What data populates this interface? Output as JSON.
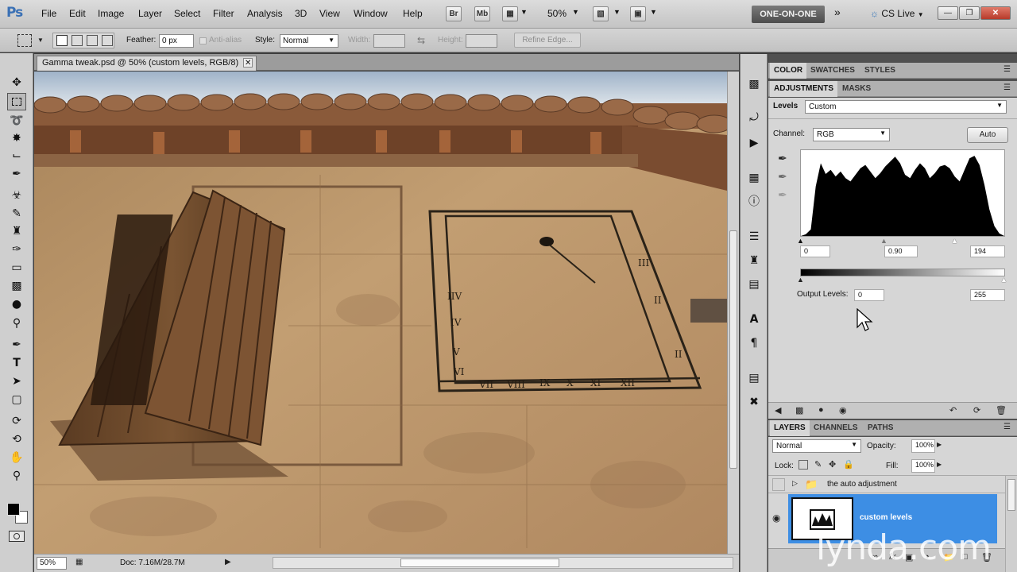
{
  "menubar": {
    "logo": "Ps",
    "items": [
      "File",
      "Edit",
      "Image",
      "Layer",
      "Select",
      "Filter",
      "Analysis",
      "3D",
      "View",
      "Window",
      "Help"
    ],
    "br_label": "Br",
    "mb_label": "Mb",
    "zoom": "50%",
    "workspace": "ONE-ON-ONE",
    "cslive": "CS Live"
  },
  "options": {
    "feather_label": "Feather:",
    "feather_value": "0 px",
    "antialias_label": "Anti-alias",
    "style_label": "Style:",
    "style_value": "Normal",
    "width_label": "Width:",
    "height_label": "Height:",
    "refine_edge": "Refine Edge..."
  },
  "document": {
    "tab_title": "Gamma tweak.psd @ 50% (custom levels, RGB/8)",
    "zoom_field": "50%",
    "doc_size": "Doc: 7.16M/28.7M"
  },
  "panels": {
    "color_tabs": [
      "COLOR",
      "SWATCHES",
      "STYLES"
    ],
    "adj_tabs": [
      "ADJUSTMENTS",
      "MASKS"
    ],
    "levels_label": "Levels",
    "preset_value": "Custom",
    "channel_label": "Channel:",
    "channel_value": "RGB",
    "auto_button": "Auto",
    "input_black": "0",
    "input_gamma": "0.90",
    "input_white": "194",
    "output_label": "Output Levels:",
    "output_black": "0",
    "output_white": "255",
    "layer_tabs": [
      "LAYERS",
      "CHANNELS",
      "PATHS"
    ],
    "blend_mode": "Normal",
    "opacity_label": "Opacity:",
    "opacity_value": "100%",
    "lock_label": "Lock:",
    "fill_label": "Fill:",
    "fill_value": "100%",
    "layers": [
      {
        "name": "the auto adjustment",
        "type": "group"
      },
      {
        "name": "custom levels",
        "type": "levels",
        "selected": true
      }
    ]
  },
  "chart_data": {
    "type": "area",
    "title": "",
    "series": [
      {
        "values": [
          0,
          2,
          8,
          60,
          88,
          75,
          80,
          72,
          78,
          70,
          66,
          74,
          82,
          86,
          78,
          70,
          76,
          84,
          90,
          96,
          88,
          74,
          70,
          80,
          88,
          82,
          70,
          76,
          84,
          86,
          82,
          72,
          66,
          80,
          94,
          97,
          86,
          62,
          32,
          12,
          3,
          0
        ]
      }
    ],
    "input_levels": [
      0,
      0.9,
      194
    ],
    "output_levels": [
      0,
      255
    ]
  },
  "watermark": "lynda.com",
  "colors": {
    "accent": "#3d8ee4",
    "layer_selected": "#3d8ee4"
  }
}
